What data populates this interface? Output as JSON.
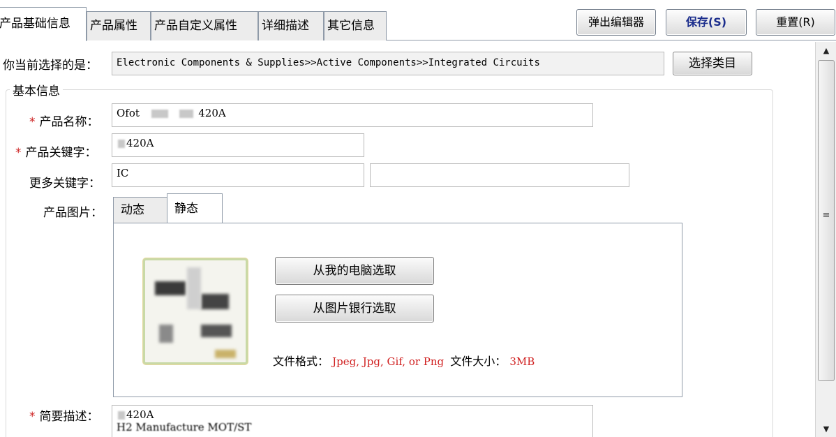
{
  "tabs": [
    "产品基础信息",
    "产品属性",
    "产品自定义属性",
    "详细描述",
    "其它信息"
  ],
  "toolbar": {
    "popup_editor": "弹出编辑器",
    "save": "保存(S)",
    "reset": "重置(R)"
  },
  "category": {
    "label": "你当前选择的是：",
    "path": "Electronic Components & Supplies>>Active Components>>Integrated Circuits",
    "select_button": "选择类目"
  },
  "basic_info": {
    "group_title": "基本信息",
    "required_mark": "*",
    "product_name_label": "产品名称：",
    "product_name_prefix": "Ofot",
    "product_name_suffix": "420A",
    "keyword_label": "产品关键字：",
    "keyword_suffix": "420A",
    "more_keywords_label": "更多关键字：",
    "more_keyword_1": "IC",
    "more_keyword_2": "",
    "image_label": "产品图片："
  },
  "image": {
    "tabs": [
      "动态",
      "静态"
    ],
    "active_tab": "静态",
    "from_computer": "从我的电脑选取",
    "from_bank": "从图片银行选取",
    "format_label": "文件格式：",
    "formats": "Jpeg, Jpg, Gif, or Png",
    "size_label": "文件大小：",
    "size": "3MB"
  },
  "summary": {
    "label": "简要描述：",
    "line1": "420A",
    "line2": "H2 Manufacture MOT/ST"
  },
  "colors": {
    "required": "#cc1f1f",
    "save_text": "#1b2d8c",
    "hint_red": "#d01f1f"
  }
}
